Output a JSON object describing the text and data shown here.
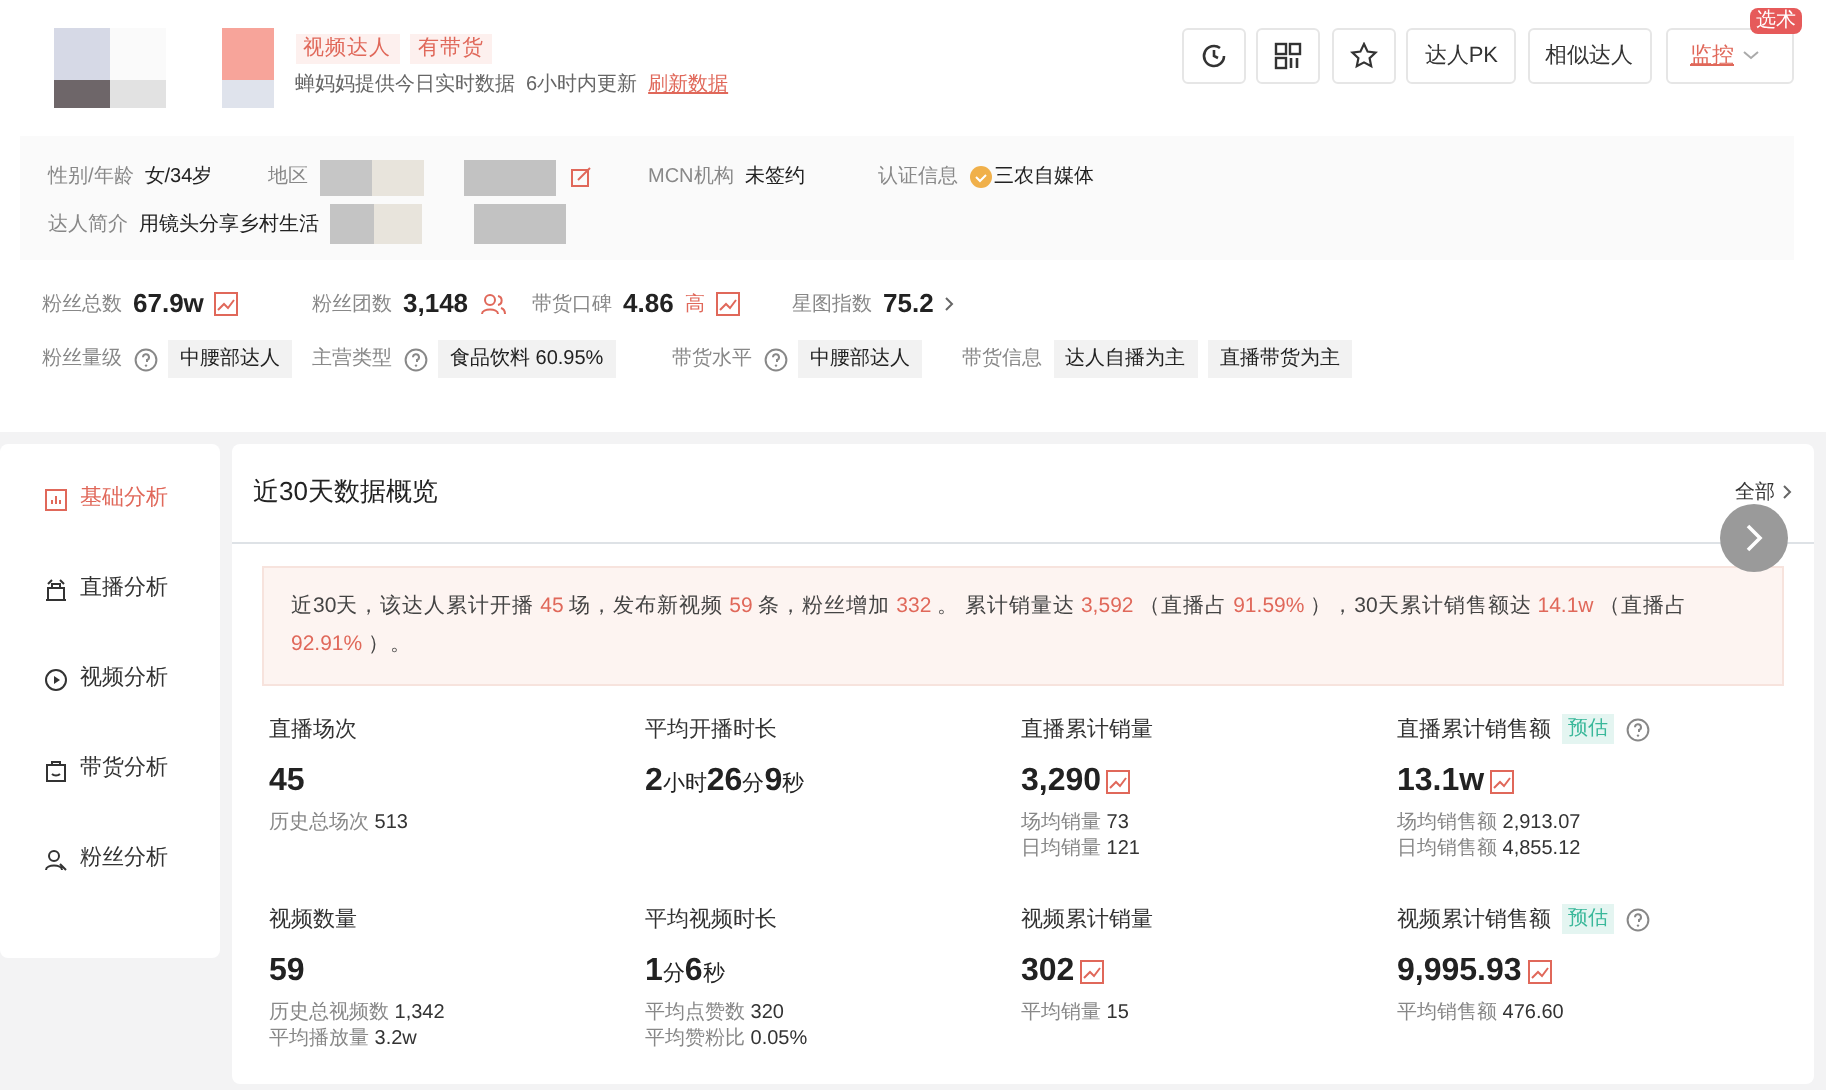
{
  "header": {
    "tags": [
      "视频达人",
      "有带货"
    ],
    "subtitle": "蝉妈妈提供今日实时数据",
    "update_note": "6小时内更新",
    "refresh_link": "刷新数据",
    "actions": [
      {
        "kind": "history"
      },
      {
        "kind": "qrcode"
      },
      {
        "kind": "star"
      },
      {
        "kind": "text",
        "label": "达人PK"
      },
      {
        "kind": "text",
        "label": "相似达人"
      },
      {
        "kind": "monitor",
        "label": "监控",
        "badge": "选术"
      }
    ]
  },
  "info": [
    {
      "label": "性别/年龄",
      "value": "女/34岁",
      "kind": "plain"
    },
    {
      "label": "地区",
      "kind": "region"
    },
    {
      "label": "MCN机构",
      "value": "未签约",
      "kind": "plain"
    },
    {
      "label": "认证信息",
      "value": "三农自媒体",
      "kind": "verified"
    }
  ],
  "bio": {
    "label": "达人简介",
    "value": "用镜头分享乡村生活"
  },
  "metrics": [
    {
      "label": "粉丝总数",
      "value": "67.9w",
      "kind": "trend"
    },
    {
      "label": "粉丝团数",
      "value": "3,148",
      "kind": "people"
    },
    {
      "label": "带货口碑",
      "value": "4.86",
      "level_tag": "高",
      "kind": "trend"
    },
    {
      "label": "星图指数",
      "value": "75.2",
      "kind": "more"
    }
  ],
  "tag_rows": [
    {
      "label": "粉丝量级",
      "help": true,
      "tags": [
        "中腰部达人"
      ]
    },
    {
      "label": "主营类型",
      "help": true,
      "tags": [
        "食品饮料 60.95%"
      ]
    },
    {
      "label": "带货水平",
      "help": true,
      "tags": [
        "中腰部达人"
      ]
    },
    {
      "label": "带货信息",
      "help": false,
      "tags": [
        "达人自播为主",
        "直播带货为主"
      ]
    }
  ],
  "sidebar": [
    {
      "label": "基础分析",
      "selected": true
    },
    {
      "label": "直播分析",
      "selected": false
    },
    {
      "label": "视频分析",
      "selected": false
    },
    {
      "label": "带货分析",
      "selected": false
    },
    {
      "label": "粉丝分析",
      "selected": false
    }
  ],
  "overview": {
    "title": "近30天数据概览",
    "all_link": "全部",
    "summary": [
      {
        "text": "近30天，该达人累计开播 ",
        "kind": "plain"
      },
      {
        "text": "45",
        "kind": "num"
      },
      {
        "text": " 场，发布新视频 ",
        "kind": "plain"
      },
      {
        "text": "59",
        "kind": "num"
      },
      {
        "text": " 条，粉丝增加 ",
        "kind": "plain"
      },
      {
        "text": "332",
        "kind": "num"
      },
      {
        "text": " 。 累计销量达 ",
        "kind": "plain"
      },
      {
        "text": "3,592",
        "kind": "num"
      },
      {
        "text": " （直播占 ",
        "kind": "plain"
      },
      {
        "text": "91.59%",
        "kind": "num"
      },
      {
        "text": " ），30天累计销售额达 ",
        "kind": "plain"
      },
      {
        "text": "14.1w",
        "kind": "num"
      },
      {
        "text": " （直播占 ",
        "kind": "plain"
      },
      {
        "text": "92.91%",
        "kind": "num"
      },
      {
        "text": " ）。",
        "kind": "plain"
      }
    ],
    "stats": [
      {
        "label": "直播场次",
        "estimate": false,
        "trend": false,
        "value": [
          {
            "text": "45",
            "kind": "num"
          }
        ],
        "subs": [
          {
            "label": "历史总场次",
            "value": "513"
          }
        ]
      },
      {
        "label": "平均开播时长",
        "estimate": false,
        "trend": false,
        "value": [
          {
            "text": "2",
            "kind": "num"
          },
          {
            "text": "小时",
            "kind": "unit"
          },
          {
            "text": "26",
            "kind": "num"
          },
          {
            "text": "分",
            "kind": "unit"
          },
          {
            "text": "9",
            "kind": "num"
          },
          {
            "text": "秒",
            "kind": "unit"
          }
        ]
      },
      {
        "label": "直播累计销量",
        "estimate": false,
        "trend": true,
        "value": [
          {
            "text": "3,290",
            "kind": "num"
          }
        ],
        "subs": [
          {
            "label": "场均销量",
            "value": "73"
          },
          {
            "label": "日均销量",
            "value": "121"
          }
        ]
      },
      {
        "label": "直播累计销售额",
        "estimate": true,
        "badge": "预估",
        "trend": true,
        "value": [
          {
            "text": "13.1w",
            "kind": "num"
          }
        ],
        "subs": [
          {
            "label": "场均销售额",
            "value": "2,913.07"
          },
          {
            "label": "日均销售额",
            "value": "4,855.12"
          }
        ]
      },
      {
        "label": "视频数量",
        "estimate": false,
        "trend": false,
        "value": [
          {
            "text": "59",
            "kind": "num"
          }
        ],
        "subs": [
          {
            "label": "历史总视频数",
            "value": "1,342"
          },
          {
            "label": "平均播放量",
            "value": "3.2w"
          }
        ]
      },
      {
        "label": "平均视频时长",
        "estimate": false,
        "trend": false,
        "value": [
          {
            "text": "1",
            "kind": "num"
          },
          {
            "text": "分",
            "kind": "unit"
          },
          {
            "text": "6",
            "kind": "num"
          },
          {
            "text": "秒",
            "kind": "unit"
          }
        ],
        "subs": [
          {
            "label": "平均点赞数",
            "value": "320"
          },
          {
            "label": "平均赞粉比",
            "value": "0.05%"
          }
        ]
      },
      {
        "label": "视频累计销量",
        "estimate": false,
        "trend": true,
        "value": [
          {
            "text": "302",
            "kind": "num"
          }
        ],
        "subs": [
          {
            "label": "平均销量",
            "value": "15"
          }
        ]
      },
      {
        "label": "视频累计销售额",
        "estimate": true,
        "badge": "预估",
        "trend": true,
        "value": [
          {
            "text": "9,995.93",
            "kind": "num"
          }
        ],
        "subs": [
          {
            "label": "平均销售额",
            "value": "476.60"
          }
        ]
      }
    ]
  }
}
